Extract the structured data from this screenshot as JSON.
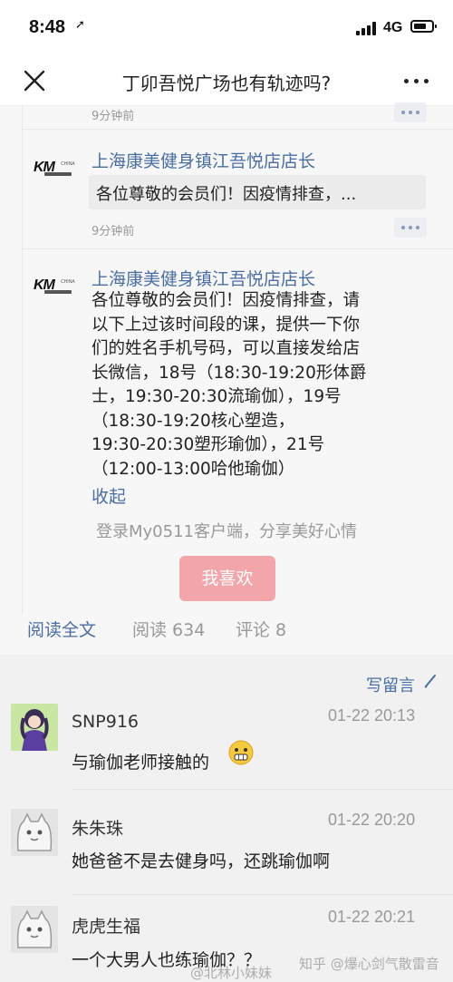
{
  "status_bar": {
    "time": "8:48",
    "network": "4G"
  },
  "nav": {
    "title": "丁卯吾悦广场也有轨迹吗?"
  },
  "feed": {
    "top_partial_time": "9分钟前",
    "preview_item": {
      "author": "上海康美健身镇江吾悦店店长",
      "preview": "各位尊敬的会员们！因疫情排查，...",
      "time": "9分钟前"
    },
    "expanded_item": {
      "author": "上海康美健身镇江吾悦店店长",
      "lines": [
        "各位尊敬的会员们！因疫情排查，请",
        "以下上过该时间段的课，提供一下你",
        "们的姓名手机号码，可以直接发给店",
        "长微信，18号（18:30-19:20形体爵",
        "士，19:30-20:30流瑜伽），19号",
        "（18:30-19:20核心塑造，",
        "19:30-20:30塑形瑜伽），21号",
        "（12:00-13:00哈他瑜伽）"
      ],
      "collapse_label": "收起"
    },
    "logo": {
      "brand": "KM",
      "region": "CHINA"
    }
  },
  "login_hint": "登录My0511客户端，分享美好心情",
  "like_button": "我喜欢",
  "footer": {
    "read_full": "阅读全文",
    "reads": "阅读 634",
    "comments": "评论 8"
  },
  "write_message": "写留言",
  "comments": [
    {
      "name": "SNP916",
      "time": "01-22 20:13",
      "text": "与瑜伽老师接触的",
      "emoji": "grimace-emoji-icon"
    },
    {
      "name": "朱朱珠",
      "time": "01-22 20:20",
      "text": "她爸爸不是去健身吗，还跳瑜伽啊"
    },
    {
      "name": "虎虎生福",
      "time": "01-22 20:21",
      "text": "一个大男人也练瑜伽？？"
    }
  ],
  "watermarks": {
    "weibo": "@北林小妹妹",
    "zhihu": "知乎 @爆心剑气散雷音"
  },
  "colors": {
    "link_blue": "#4a6ea3",
    "like_pink": "#f3a6a9",
    "gray_text": "#999999"
  }
}
